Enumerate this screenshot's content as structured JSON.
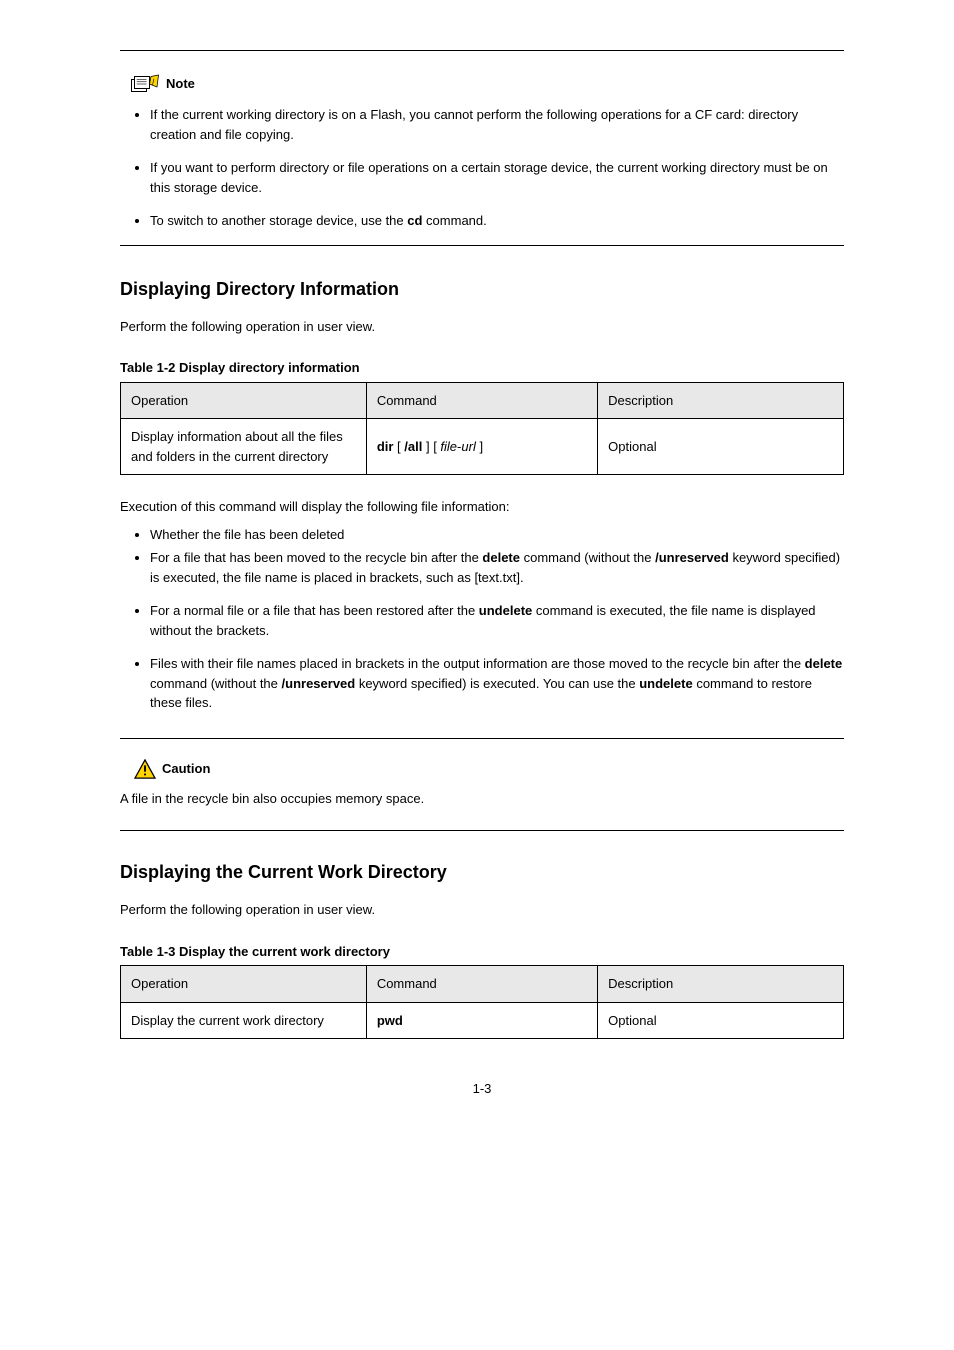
{
  "note": {
    "label": "Note",
    "bullets": [
      "If the current working directory is on a Flash, you cannot perform the following operations for a CF card: directory creation and file copying.",
      "If you want to perform directory or file operations on a certain storage device, the current working directory must be on this storage device.",
      "To switch to another storage device, use the <b>cd</b> command."
    ]
  },
  "dir_section": {
    "heading": "Displaying Directory Information",
    "intro": "Perform the following operation in user view.",
    "table_caption": "Table 1-2 <span>Display directory information</span>",
    "table": {
      "headers": [
        "Operation",
        "Command",
        "Description"
      ],
      "rows": [
        [
          "Display information about all the files and folders in the current directory",
          "<b>dir</b> [ <b>/all</b> ] [ <i>file</i>-<i>url</i> ]",
          "Optional"
        ]
      ]
    },
    "exec_label": "Execution of this command will display the following file information:",
    "exec_bullets": [
      "Whether the file has been deleted",
      "For a file that has been moved to the recycle bin after the <b>delete</b> command (without the <b>/unreserved</b> keyword specified) is executed, the file name is placed in brackets, such as [text.txt].",
      "For a normal file or a file that has been restored after the <b>undelete</b> command is executed, the file name is displayed without the brackets.",
      "Files with their file names placed in brackets in the output information are those moved to the recycle bin after the <b>delete</b> command (without the <b>/unreserved</b> keyword specified) is executed. You can use the <b>undelete</b> command to restore these files."
    ]
  },
  "caution": {
    "label": "Caution",
    "text": "A file in the recycle bin also occupies memory space."
  },
  "cwd_section": {
    "heading": "Displaying the Current Work Directory",
    "intro": "Perform the following operation in user view.",
    "table_caption": "Table 1-3 <span>Display the current work directory</span>",
    "table": {
      "headers": [
        "Operation",
        "Command",
        "Description"
      ],
      "rows": [
        [
          "Display the current work directory",
          "<b>pwd</b>",
          "Optional"
        ]
      ]
    }
  },
  "page_number": "1-3"
}
